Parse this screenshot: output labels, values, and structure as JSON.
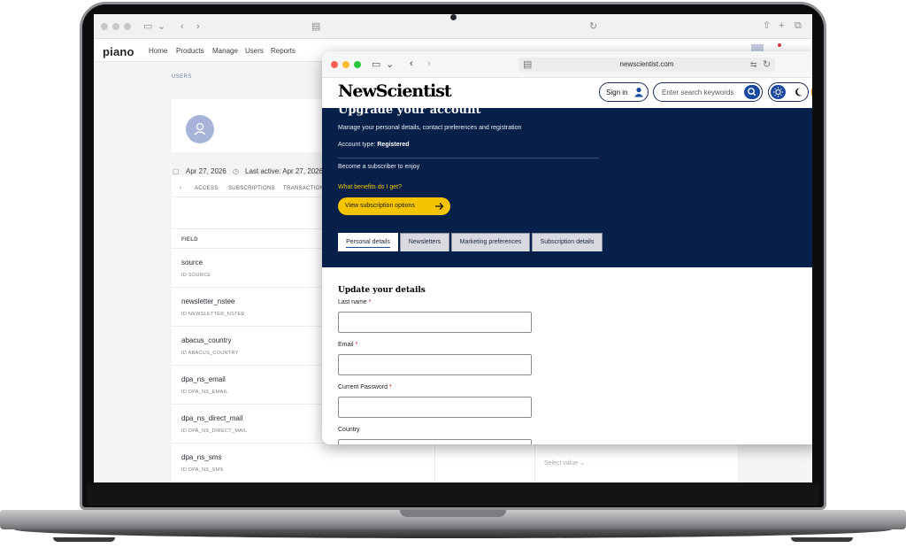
{
  "back_window": {
    "brand": "piano",
    "nav_links": [
      "Home",
      "Products",
      "Manage",
      "Users",
      "Reports"
    ],
    "section_caption": "USERS",
    "created_date": "Apr 27, 2026",
    "last_active": "Last active: Apr 27, 2026",
    "tabs": [
      "ACCESS",
      "SUBSCRIPTIONS",
      "TRANSACTIONS"
    ],
    "field_header": "FIELD",
    "fields": [
      {
        "name": "source",
        "id": "ID  SOURCE"
      },
      {
        "name": "newsletter_nstee",
        "id": "ID  NEWSLETTER_NSTEE"
      },
      {
        "name": "abacus_country",
        "id": "ID  ABACUS_COUNTRY"
      },
      {
        "name": "dpa_ns_email",
        "id": "ID  DPA_NS_EMAIL"
      },
      {
        "name": "dpa_ns_direct_mail",
        "id": "ID  DPA_NS_DIRECT_MAIL"
      },
      {
        "name": "dpa_ns_sms",
        "id": "ID  DPA_NS_SMS"
      }
    ],
    "select_placeholder": "Select value"
  },
  "front_window": {
    "url": "newscientist.com",
    "logo": "NewScientist",
    "signin_label": "Sign in",
    "search_placeholder": "Enter search keywords",
    "hero": {
      "title": "Upgrade your account",
      "description": "Manage your personal details, contact preferences and registration",
      "account_type_label": "Account type:",
      "account_type_value": "Registered",
      "subscribe_text": "Become a subscriber to enjoy",
      "benefits_link": "What benefits do I get?",
      "cta_label": "View subscription options"
    },
    "tabs": [
      "Personal details",
      "Newsletters",
      "Marketing preferences",
      "Subscription details"
    ],
    "form": {
      "heading": "Update your details",
      "last_name_label": "Last name",
      "email_label": "Email",
      "password_label": "Current Password",
      "country_label": "Country",
      "required_mark": "*"
    }
  },
  "colors": {
    "ns_navy": "#06204a",
    "ns_blue": "#1a4aa0",
    "ns_yellow": "#f5c400",
    "mac_red": "#ff5f57",
    "mac_yellow": "#febc2e",
    "mac_green": "#28c840"
  }
}
